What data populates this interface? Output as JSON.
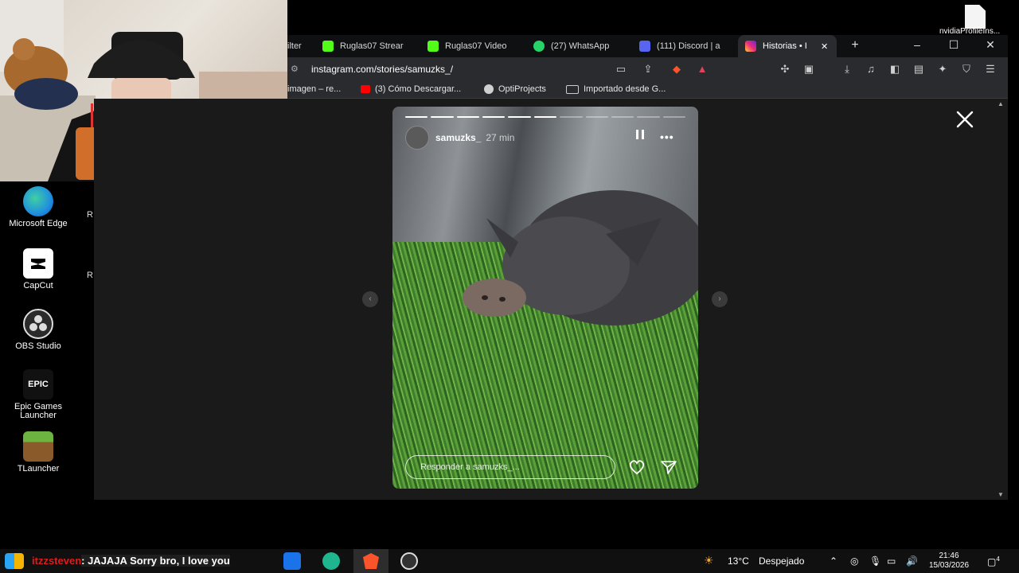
{
  "desktop": {
    "icons": [
      {
        "label": "Microsoft Edge",
        "color": "#1f8fe0"
      },
      {
        "label": "CapCut",
        "color": "#ffffff"
      },
      {
        "label": "OBS Studio",
        "color": "#2b2b2b"
      },
      {
        "label": "Epic Games Launcher",
        "color": "#1b1b1b"
      },
      {
        "label": "TLauncher",
        "color": "#5e9c3a"
      }
    ],
    "cut_labels": [
      "R",
      "R"
    ],
    "file": {
      "label": "nvidiaProfileIns..."
    }
  },
  "browser": {
    "tabs": [
      {
        "label": "ilter",
        "color": "#2a2b2f"
      },
      {
        "label": "Ruglas07 Strear",
        "color": "#53fc18"
      },
      {
        "label": "Ruglas07 Video",
        "color": "#53fc18"
      },
      {
        "label": "(27) WhatsApp",
        "color": "#25d366"
      },
      {
        "label": "(111) Discord | a",
        "color": "#5865f2"
      },
      {
        "label": "Historias • I",
        "color": "#e1306c"
      }
    ],
    "new_tab": "+",
    "window_controls": {
      "minimize": "–",
      "maximize": "☐",
      "close": "✕"
    },
    "tab_close": "✕",
    "url": "instagram.com/stories/samuzks_/",
    "bookmarks": [
      {
        "label": "imagen – re...",
        "color": "#2a2b2f"
      },
      {
        "label": "(3) Cómo Descargar...",
        "color": "#ff0000"
      },
      {
        "label": "OptiProjects",
        "color": "#d0d0d0"
      },
      {
        "label": "Importado desde G...",
        "color": "#2a2b2f"
      }
    ]
  },
  "story": {
    "username": "samuzks_",
    "time": "27 min",
    "progress_segments": 11,
    "progress_done": 6,
    "reply_placeholder": "Responder a samuzks_...",
    "more_label": "•••",
    "prev_arrow": "‹",
    "next_arrow": "›"
  },
  "taskbar": {
    "chat_user": "itzzsteven",
    "chat_message": ": JAJAJA Sorry bro, I love you",
    "weather": "13°C",
    "weather_desc": "Despejado",
    "time": "21:46",
    "date": "15/03/2026",
    "notification_count": "4"
  }
}
